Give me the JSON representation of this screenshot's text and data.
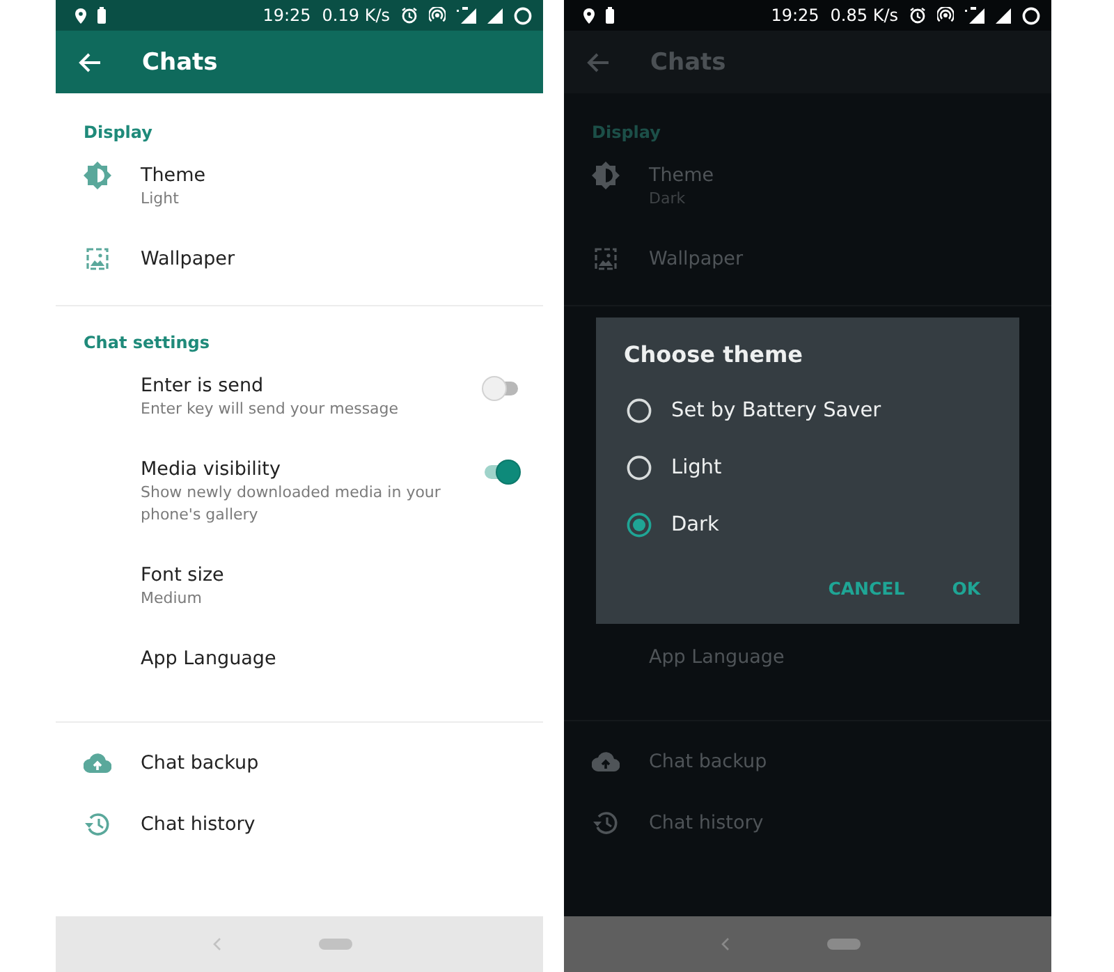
{
  "screens": [
    {
      "dark": false,
      "status_bar": {
        "time": "19:25",
        "speed": "0.19 K/s"
      },
      "toolbar": {
        "title": "Chats"
      },
      "sections": [
        {
          "header": "Display",
          "items": [
            {
              "kind": "brightness-row",
              "title": "Theme",
              "subtitle": "Light"
            },
            {
              "kind": "picture-row",
              "title": "Wallpaper"
            }
          ]
        },
        {
          "header": "Chat settings",
          "items": [
            {
              "kind": "toggle-row",
              "title": "Enter is send",
              "subtitle": "Enter key will send your message",
              "on": false
            },
            {
              "kind": "toggle-row",
              "title": "Media visibility",
              "subtitle": "Show newly downloaded media in your phone's gallery",
              "on": true
            },
            {
              "kind": "text-row",
              "title": "Font size",
              "subtitle": "Medium"
            },
            {
              "kind": "text-row",
              "title": "App Language"
            }
          ]
        },
        {
          "items": [
            {
              "kind": "cloud-row",
              "title": "Chat backup"
            },
            {
              "kind": "history-row",
              "title": "Chat history"
            }
          ]
        }
      ]
    },
    {
      "dark": true,
      "status_bar": {
        "time": "19:25",
        "speed": "0.85 K/s"
      },
      "toolbar": {
        "title": "Chats"
      },
      "sections": [
        {
          "header": "Display",
          "items": [
            {
              "kind": "brightness-row",
              "title": "Theme",
              "subtitle": "Dark"
            },
            {
              "kind": "picture-row",
              "title": "Wallpaper"
            }
          ]
        },
        {
          "items": [
            {
              "kind": "text-row",
              "title": "App Language"
            }
          ]
        },
        {
          "items": [
            {
              "kind": "cloud-row",
              "title": "Chat backup"
            },
            {
              "kind": "history-row",
              "title": "Chat history"
            }
          ]
        }
      ],
      "dialog": {
        "title": "Choose theme",
        "options": [
          {
            "label": "Set by Battery Saver",
            "selected": false
          },
          {
            "label": "Light",
            "selected": false
          },
          {
            "label": "Dark",
            "selected": true
          }
        ],
        "buttons": [
          "CANCEL",
          "OK"
        ]
      }
    }
  ]
}
